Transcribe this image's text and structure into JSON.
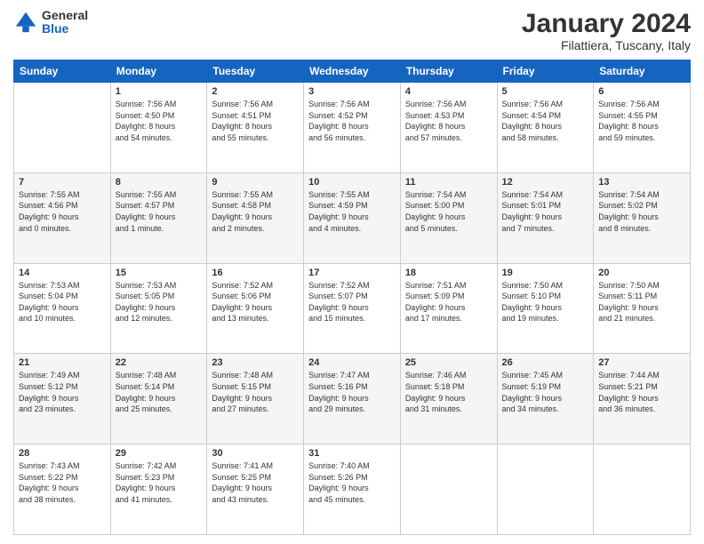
{
  "header": {
    "logo_general": "General",
    "logo_blue": "Blue",
    "title": "January 2024",
    "subtitle": "Filattiera, Tuscany, Italy"
  },
  "columns": [
    "Sunday",
    "Monday",
    "Tuesday",
    "Wednesday",
    "Thursday",
    "Friday",
    "Saturday"
  ],
  "weeks": [
    [
      {
        "day": "",
        "info": ""
      },
      {
        "day": "1",
        "info": "Sunrise: 7:56 AM\nSunset: 4:50 PM\nDaylight: 8 hours\nand 54 minutes."
      },
      {
        "day": "2",
        "info": "Sunrise: 7:56 AM\nSunset: 4:51 PM\nDaylight: 8 hours\nand 55 minutes."
      },
      {
        "day": "3",
        "info": "Sunrise: 7:56 AM\nSunset: 4:52 PM\nDaylight: 8 hours\nand 56 minutes."
      },
      {
        "day": "4",
        "info": "Sunrise: 7:56 AM\nSunset: 4:53 PM\nDaylight: 8 hours\nand 57 minutes."
      },
      {
        "day": "5",
        "info": "Sunrise: 7:56 AM\nSunset: 4:54 PM\nDaylight: 8 hours\nand 58 minutes."
      },
      {
        "day": "6",
        "info": "Sunrise: 7:56 AM\nSunset: 4:55 PM\nDaylight: 8 hours\nand 59 minutes."
      }
    ],
    [
      {
        "day": "7",
        "info": "Sunrise: 7:55 AM\nSunset: 4:56 PM\nDaylight: 9 hours\nand 0 minutes."
      },
      {
        "day": "8",
        "info": "Sunrise: 7:55 AM\nSunset: 4:57 PM\nDaylight: 9 hours\nand 1 minute."
      },
      {
        "day": "9",
        "info": "Sunrise: 7:55 AM\nSunset: 4:58 PM\nDaylight: 9 hours\nand 2 minutes."
      },
      {
        "day": "10",
        "info": "Sunrise: 7:55 AM\nSunset: 4:59 PM\nDaylight: 9 hours\nand 4 minutes."
      },
      {
        "day": "11",
        "info": "Sunrise: 7:54 AM\nSunset: 5:00 PM\nDaylight: 9 hours\nand 5 minutes."
      },
      {
        "day": "12",
        "info": "Sunrise: 7:54 AM\nSunset: 5:01 PM\nDaylight: 9 hours\nand 7 minutes."
      },
      {
        "day": "13",
        "info": "Sunrise: 7:54 AM\nSunset: 5:02 PM\nDaylight: 9 hours\nand 8 minutes."
      }
    ],
    [
      {
        "day": "14",
        "info": "Sunrise: 7:53 AM\nSunset: 5:04 PM\nDaylight: 9 hours\nand 10 minutes."
      },
      {
        "day": "15",
        "info": "Sunrise: 7:53 AM\nSunset: 5:05 PM\nDaylight: 9 hours\nand 12 minutes."
      },
      {
        "day": "16",
        "info": "Sunrise: 7:52 AM\nSunset: 5:06 PM\nDaylight: 9 hours\nand 13 minutes."
      },
      {
        "day": "17",
        "info": "Sunrise: 7:52 AM\nSunset: 5:07 PM\nDaylight: 9 hours\nand 15 minutes."
      },
      {
        "day": "18",
        "info": "Sunrise: 7:51 AM\nSunset: 5:09 PM\nDaylight: 9 hours\nand 17 minutes."
      },
      {
        "day": "19",
        "info": "Sunrise: 7:50 AM\nSunset: 5:10 PM\nDaylight: 9 hours\nand 19 minutes."
      },
      {
        "day": "20",
        "info": "Sunrise: 7:50 AM\nSunset: 5:11 PM\nDaylight: 9 hours\nand 21 minutes."
      }
    ],
    [
      {
        "day": "21",
        "info": "Sunrise: 7:49 AM\nSunset: 5:12 PM\nDaylight: 9 hours\nand 23 minutes."
      },
      {
        "day": "22",
        "info": "Sunrise: 7:48 AM\nSunset: 5:14 PM\nDaylight: 9 hours\nand 25 minutes."
      },
      {
        "day": "23",
        "info": "Sunrise: 7:48 AM\nSunset: 5:15 PM\nDaylight: 9 hours\nand 27 minutes."
      },
      {
        "day": "24",
        "info": "Sunrise: 7:47 AM\nSunset: 5:16 PM\nDaylight: 9 hours\nand 29 minutes."
      },
      {
        "day": "25",
        "info": "Sunrise: 7:46 AM\nSunset: 5:18 PM\nDaylight: 9 hours\nand 31 minutes."
      },
      {
        "day": "26",
        "info": "Sunrise: 7:45 AM\nSunset: 5:19 PM\nDaylight: 9 hours\nand 34 minutes."
      },
      {
        "day": "27",
        "info": "Sunrise: 7:44 AM\nSunset: 5:21 PM\nDaylight: 9 hours\nand 36 minutes."
      }
    ],
    [
      {
        "day": "28",
        "info": "Sunrise: 7:43 AM\nSunset: 5:22 PM\nDaylight: 9 hours\nand 38 minutes."
      },
      {
        "day": "29",
        "info": "Sunrise: 7:42 AM\nSunset: 5:23 PM\nDaylight: 9 hours\nand 41 minutes."
      },
      {
        "day": "30",
        "info": "Sunrise: 7:41 AM\nSunset: 5:25 PM\nDaylight: 9 hours\nand 43 minutes."
      },
      {
        "day": "31",
        "info": "Sunrise: 7:40 AM\nSunset: 5:26 PM\nDaylight: 9 hours\nand 45 minutes."
      },
      {
        "day": "",
        "info": ""
      },
      {
        "day": "",
        "info": ""
      },
      {
        "day": "",
        "info": ""
      }
    ]
  ]
}
